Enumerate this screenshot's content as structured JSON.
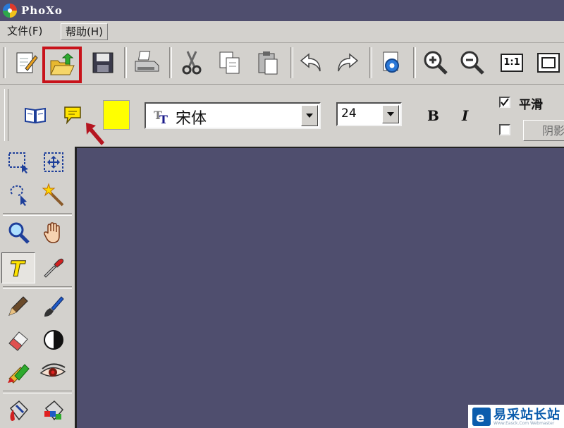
{
  "window": {
    "title": "PhoXo"
  },
  "menu": {
    "file": "文件(F)",
    "help": "帮助(H)"
  },
  "toolbar": {
    "buttons": [
      "new-document-icon",
      "open-file-icon",
      "save-icon",
      "print-icon",
      "cut-icon",
      "copy-icon",
      "paste-icon",
      "undo-icon",
      "redo-icon",
      "settings-icon",
      "zoom-in-icon",
      "zoom-out-icon",
      "actual-size-icon",
      "fit-window-icon"
    ],
    "actual_size_label": "1:1",
    "highlighted": "open-file-icon",
    "highlight_color": "#c8121a"
  },
  "text_options": {
    "text_color": "#ffff00",
    "font": "宋体",
    "size": "24",
    "bold_label": "B",
    "italic_label": "I",
    "smooth_label": "平滑",
    "smooth_checked": true,
    "shadow_label": "阴影",
    "shadow_checked": false
  },
  "tools": [
    "rect-select-icon",
    "move-select-icon",
    "lasso-select-icon",
    "magic-wand-icon",
    "zoom-icon",
    "hand-icon",
    "text-tool-icon",
    "eyedropper-icon",
    "pen-icon",
    "brush-icon",
    "eraser-icon",
    "contrast-icon",
    "clone-icon",
    "red-eye-icon",
    "bucket-icon",
    "gradient-icon"
  ],
  "active_tool": "text-tool-icon",
  "colors": {
    "canvas": "#4f4e6e",
    "panel": "#d3d1cd"
  },
  "watermark": {
    "text": "易采站长站",
    "sub": "Www.Easck.Com  Webmaster"
  }
}
